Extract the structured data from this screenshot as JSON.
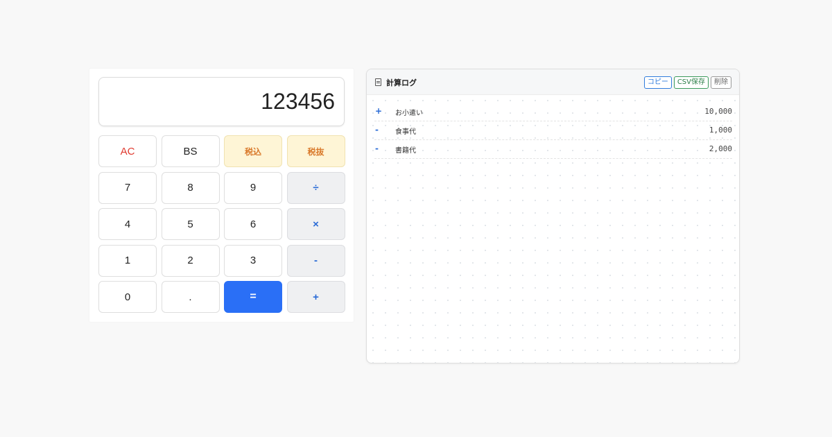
{
  "calculator": {
    "display": "123456",
    "keys": {
      "ac": "AC",
      "bs": "BS",
      "tax_in": "税込",
      "tax_ex": "税抜",
      "k7": "7",
      "k8": "8",
      "k9": "9",
      "divide": "÷",
      "k4": "4",
      "k5": "5",
      "k6": "6",
      "multiply": "×",
      "k1": "1",
      "k2": "2",
      "k3": "3",
      "minus": "-",
      "k0": "0",
      "dot": ".",
      "equals": "=",
      "plus": "+"
    }
  },
  "log": {
    "icon": "document-icon",
    "title": "計算ログ",
    "buttons": {
      "copy": "コピー",
      "csv": "CSV保存",
      "delete": "削除"
    },
    "entries": [
      {
        "sign": "+",
        "label": "お小遣い",
        "amount": "10,000"
      },
      {
        "sign": "-",
        "label": "食事代",
        "amount": "1,000"
      },
      {
        "sign": "-",
        "label": "書籍代",
        "amount": "2,000"
      }
    ]
  },
  "colors": {
    "accent": "#2a6ff6",
    "clear": "#e03a2f",
    "tax": "#d9792a",
    "operator": "#2a6bd6"
  }
}
